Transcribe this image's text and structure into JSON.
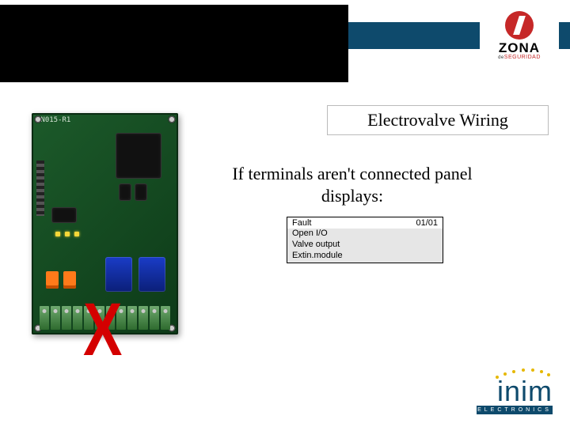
{
  "header": {
    "logo_zona": {
      "brand": "ZONA",
      "tag_prefix": "de",
      "tag": "SEGURIDAD"
    }
  },
  "title": "Electrovalve Wiring",
  "body_text": "If terminals aren't connected panel displays:",
  "display": {
    "line1_left": "Fault",
    "line1_right": "01/01",
    "line2": "Open I/O",
    "line3": "Valve output",
    "line4": "Extin.module"
  },
  "pcb": {
    "label": "IN015-R1"
  },
  "mark": "X",
  "footer": {
    "inim_brand": "inim",
    "inim_sub": "ELECTRONICS"
  }
}
